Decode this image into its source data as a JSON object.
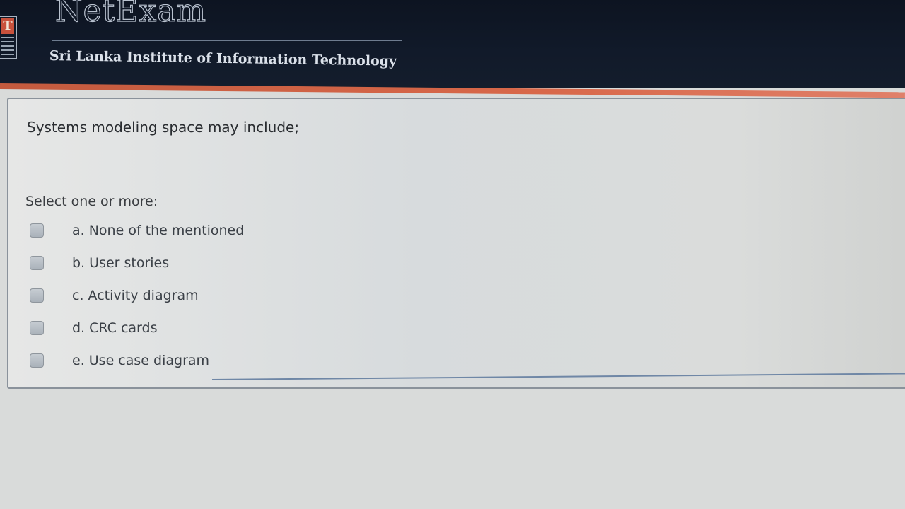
{
  "header": {
    "brand": "NetExam",
    "institute": "Sri Lanka Institute of Information Technology"
  },
  "question": {
    "text": "Systems modeling space may include;",
    "prompt": "Select one or more:",
    "options": [
      {
        "label": "a. None of the mentioned",
        "checked": false
      },
      {
        "label": "b. User stories",
        "checked": false
      },
      {
        "label": "c. Activity diagram",
        "checked": false
      },
      {
        "label": "d. CRC cards",
        "checked": false
      },
      {
        "label": "e. Use case diagram",
        "checked": false
      }
    ]
  },
  "colors": {
    "header_bg": "#111a2a",
    "accent": "#d8684a",
    "panel_border": "#8a929b"
  }
}
